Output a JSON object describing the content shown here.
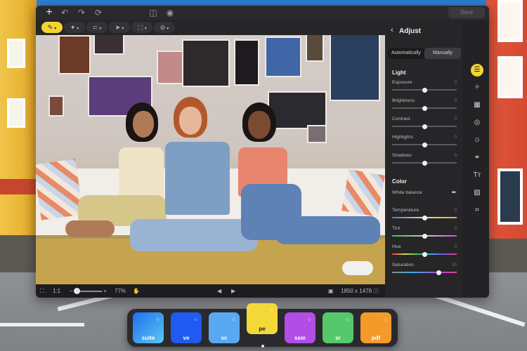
{
  "app": {
    "save_label": "Save",
    "toolbar": {
      "tools": [
        "brush-tool",
        "retouch-tool",
        "lasso-tool",
        "selection-tool",
        "marquee-tool",
        "link-tool"
      ]
    },
    "status": {
      "ratio": "1:1",
      "zoom_minus": "−",
      "zoom_plus": "+",
      "zoom": "77%",
      "dimensions": "1850 x 1478"
    }
  },
  "adjust": {
    "title": "Adjust",
    "tabs": [
      "Automatically",
      "Manually"
    ],
    "active_tab": "Manually",
    "light_title": "Light",
    "light": [
      {
        "label": "Exposure",
        "value": "0",
        "level": 0.5
      },
      {
        "label": "Brightness",
        "value": "0",
        "level": 0.5
      },
      {
        "label": "Contrast",
        "value": "0",
        "level": 0.5
      },
      {
        "label": "Highlights",
        "value": "0",
        "level": 0.5
      },
      {
        "label": "Shadows",
        "value": "0",
        "level": 0.5
      }
    ],
    "color_title": "Color",
    "white_balance": "White balance",
    "color": [
      {
        "label": "Temperature",
        "value": "0",
        "level": 0.5,
        "track": "linear-gradient(90deg,#3a7ee8,#e8e27a,#f0a23a)"
      },
      {
        "label": "Tint",
        "value": "0",
        "level": 0.5,
        "track": "linear-gradient(90deg,#3cc05a,#c9c9c9,#d54bd6)"
      },
      {
        "label": "Hue",
        "value": "0",
        "level": 0.5,
        "track": "linear-gradient(90deg,#e24040,#e6d23a,#3cc05a,#3ab0e6,#7a4ae6,#e24090)"
      },
      {
        "label": "Saturation",
        "value": "35",
        "level": 0.72,
        "track": "linear-gradient(90deg,#8a8a8a,#3ab0e6,#a94ae6,#e24090)"
      }
    ]
  },
  "rail": [
    "adjust-icon",
    "magic-wand-icon",
    "crop-grid-icon",
    "retouch-icon",
    "face-icon",
    "color-filter-icon",
    "text-icon",
    "image-icon",
    "crop-icon"
  ],
  "dock": [
    {
      "label": "suite",
      "color": "linear-gradient(135deg,#1e6ff0,#5cc7f0)"
    },
    {
      "label": "ve",
      "color": "#1f5bf0"
    },
    {
      "label": "vc",
      "color": "#59a9f2"
    },
    {
      "label": "pe",
      "color": "#f3d83a"
    },
    {
      "label": "ssm",
      "color": "#b24de6"
    },
    {
      "label": "sr",
      "color": "#55c86c"
    },
    {
      "label": "pdf",
      "color": "#f39a2a"
    }
  ]
}
